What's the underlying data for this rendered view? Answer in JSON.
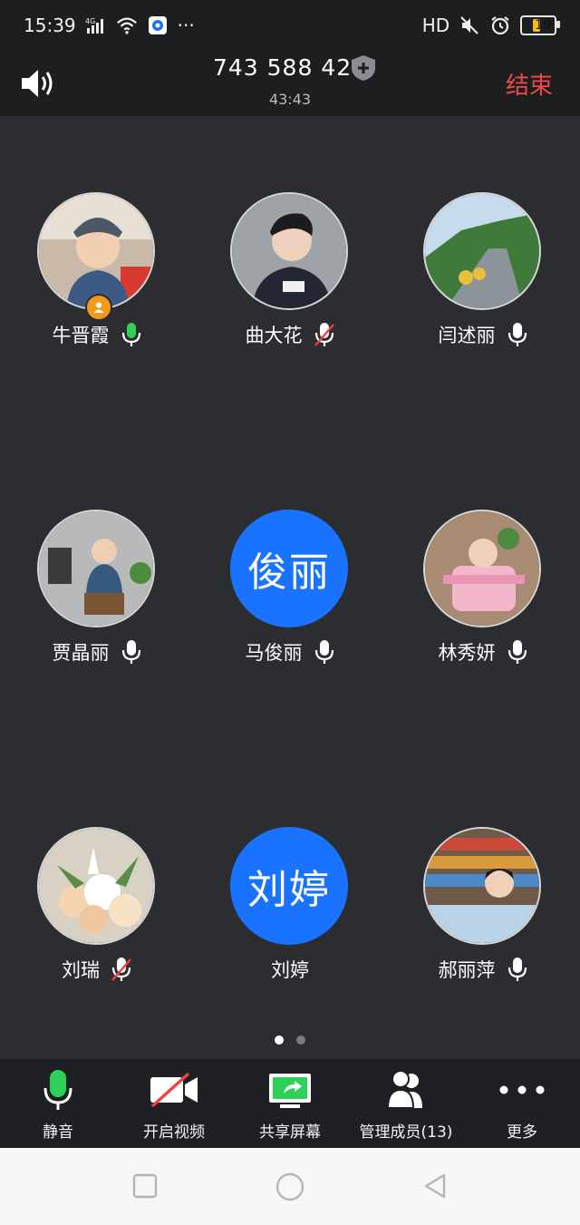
{
  "statusbar": {
    "time": "15:39",
    "network": "4G",
    "dots": "···",
    "hd": "HD",
    "battery": "19"
  },
  "header": {
    "meeting_id": "743 588 426",
    "duration": "43:43",
    "end_label": "结束"
  },
  "participants": [
    {
      "name": "牛晋霞",
      "mic": "active",
      "avatar": "photo-boy-hat",
      "host": true
    },
    {
      "name": "曲大花",
      "mic": "muted",
      "avatar": "photo-man-suit",
      "host": false
    },
    {
      "name": "闫述丽",
      "mic": "on",
      "avatar": "photo-mountain-road",
      "host": false
    },
    {
      "name": "贾晶丽",
      "mic": "on",
      "avatar": "photo-child-chair",
      "host": false
    },
    {
      "name": "马俊丽",
      "mic": "on",
      "avatar": "text",
      "initials": "俊丽",
      "host": false
    },
    {
      "name": "林秀妍",
      "mic": "on",
      "avatar": "photo-baby-highchair",
      "host": false
    },
    {
      "name": "刘瑞",
      "mic": "muted",
      "avatar": "photo-flowers",
      "host": false
    },
    {
      "name": "刘婷",
      "mic": "none",
      "avatar": "text",
      "initials": "刘婷",
      "host": false
    },
    {
      "name": "郝丽萍",
      "mic": "on",
      "avatar": "photo-shop-girl",
      "host": false
    }
  ],
  "pagination": {
    "pages": 2,
    "current": 1
  },
  "toolbar": {
    "mute_label": "静音",
    "video_label": "开启视频",
    "share_label": "共享屏幕",
    "members_label": "管理成员(13)",
    "more_label": "更多"
  },
  "colors": {
    "accent_blue": "#1a73ff",
    "mic_green": "#2ed158",
    "end_red": "#f44848",
    "muted_red": "#f04040"
  }
}
